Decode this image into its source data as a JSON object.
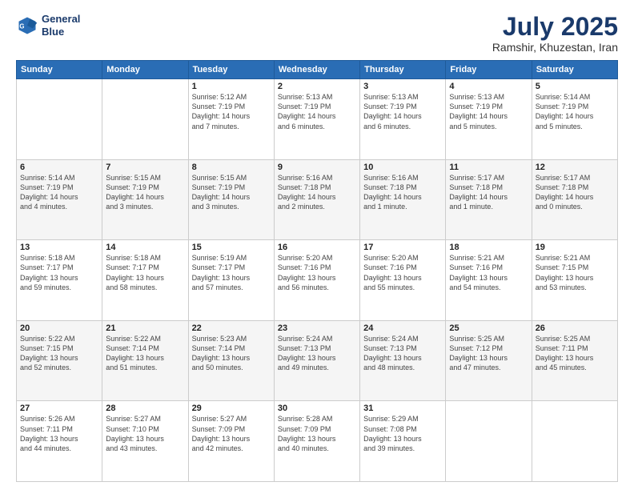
{
  "header": {
    "logo_line1": "General",
    "logo_line2": "Blue",
    "month_title": "July 2025",
    "location": "Ramshir, Khuzestan, Iran"
  },
  "days_of_week": [
    "Sunday",
    "Monday",
    "Tuesday",
    "Wednesday",
    "Thursday",
    "Friday",
    "Saturday"
  ],
  "weeks": [
    [
      {
        "day": "",
        "info": ""
      },
      {
        "day": "",
        "info": ""
      },
      {
        "day": "1",
        "info": "Sunrise: 5:12 AM\nSunset: 7:19 PM\nDaylight: 14 hours\nand 7 minutes."
      },
      {
        "day": "2",
        "info": "Sunrise: 5:13 AM\nSunset: 7:19 PM\nDaylight: 14 hours\nand 6 minutes."
      },
      {
        "day": "3",
        "info": "Sunrise: 5:13 AM\nSunset: 7:19 PM\nDaylight: 14 hours\nand 6 minutes."
      },
      {
        "day": "4",
        "info": "Sunrise: 5:13 AM\nSunset: 7:19 PM\nDaylight: 14 hours\nand 5 minutes."
      },
      {
        "day": "5",
        "info": "Sunrise: 5:14 AM\nSunset: 7:19 PM\nDaylight: 14 hours\nand 5 minutes."
      }
    ],
    [
      {
        "day": "6",
        "info": "Sunrise: 5:14 AM\nSunset: 7:19 PM\nDaylight: 14 hours\nand 4 minutes."
      },
      {
        "day": "7",
        "info": "Sunrise: 5:15 AM\nSunset: 7:19 PM\nDaylight: 14 hours\nand 3 minutes."
      },
      {
        "day": "8",
        "info": "Sunrise: 5:15 AM\nSunset: 7:19 PM\nDaylight: 14 hours\nand 3 minutes."
      },
      {
        "day": "9",
        "info": "Sunrise: 5:16 AM\nSunset: 7:18 PM\nDaylight: 14 hours\nand 2 minutes."
      },
      {
        "day": "10",
        "info": "Sunrise: 5:16 AM\nSunset: 7:18 PM\nDaylight: 14 hours\nand 1 minute."
      },
      {
        "day": "11",
        "info": "Sunrise: 5:17 AM\nSunset: 7:18 PM\nDaylight: 14 hours\nand 1 minute."
      },
      {
        "day": "12",
        "info": "Sunrise: 5:17 AM\nSunset: 7:18 PM\nDaylight: 14 hours\nand 0 minutes."
      }
    ],
    [
      {
        "day": "13",
        "info": "Sunrise: 5:18 AM\nSunset: 7:17 PM\nDaylight: 13 hours\nand 59 minutes."
      },
      {
        "day": "14",
        "info": "Sunrise: 5:18 AM\nSunset: 7:17 PM\nDaylight: 13 hours\nand 58 minutes."
      },
      {
        "day": "15",
        "info": "Sunrise: 5:19 AM\nSunset: 7:17 PM\nDaylight: 13 hours\nand 57 minutes."
      },
      {
        "day": "16",
        "info": "Sunrise: 5:20 AM\nSunset: 7:16 PM\nDaylight: 13 hours\nand 56 minutes."
      },
      {
        "day": "17",
        "info": "Sunrise: 5:20 AM\nSunset: 7:16 PM\nDaylight: 13 hours\nand 55 minutes."
      },
      {
        "day": "18",
        "info": "Sunrise: 5:21 AM\nSunset: 7:16 PM\nDaylight: 13 hours\nand 54 minutes."
      },
      {
        "day": "19",
        "info": "Sunrise: 5:21 AM\nSunset: 7:15 PM\nDaylight: 13 hours\nand 53 minutes."
      }
    ],
    [
      {
        "day": "20",
        "info": "Sunrise: 5:22 AM\nSunset: 7:15 PM\nDaylight: 13 hours\nand 52 minutes."
      },
      {
        "day": "21",
        "info": "Sunrise: 5:22 AM\nSunset: 7:14 PM\nDaylight: 13 hours\nand 51 minutes."
      },
      {
        "day": "22",
        "info": "Sunrise: 5:23 AM\nSunset: 7:14 PM\nDaylight: 13 hours\nand 50 minutes."
      },
      {
        "day": "23",
        "info": "Sunrise: 5:24 AM\nSunset: 7:13 PM\nDaylight: 13 hours\nand 49 minutes."
      },
      {
        "day": "24",
        "info": "Sunrise: 5:24 AM\nSunset: 7:13 PM\nDaylight: 13 hours\nand 48 minutes."
      },
      {
        "day": "25",
        "info": "Sunrise: 5:25 AM\nSunset: 7:12 PM\nDaylight: 13 hours\nand 47 minutes."
      },
      {
        "day": "26",
        "info": "Sunrise: 5:25 AM\nSunset: 7:11 PM\nDaylight: 13 hours\nand 45 minutes."
      }
    ],
    [
      {
        "day": "27",
        "info": "Sunrise: 5:26 AM\nSunset: 7:11 PM\nDaylight: 13 hours\nand 44 minutes."
      },
      {
        "day": "28",
        "info": "Sunrise: 5:27 AM\nSunset: 7:10 PM\nDaylight: 13 hours\nand 43 minutes."
      },
      {
        "day": "29",
        "info": "Sunrise: 5:27 AM\nSunset: 7:09 PM\nDaylight: 13 hours\nand 42 minutes."
      },
      {
        "day": "30",
        "info": "Sunrise: 5:28 AM\nSunset: 7:09 PM\nDaylight: 13 hours\nand 40 minutes."
      },
      {
        "day": "31",
        "info": "Sunrise: 5:29 AM\nSunset: 7:08 PM\nDaylight: 13 hours\nand 39 minutes."
      },
      {
        "day": "",
        "info": ""
      },
      {
        "day": "",
        "info": ""
      }
    ]
  ]
}
